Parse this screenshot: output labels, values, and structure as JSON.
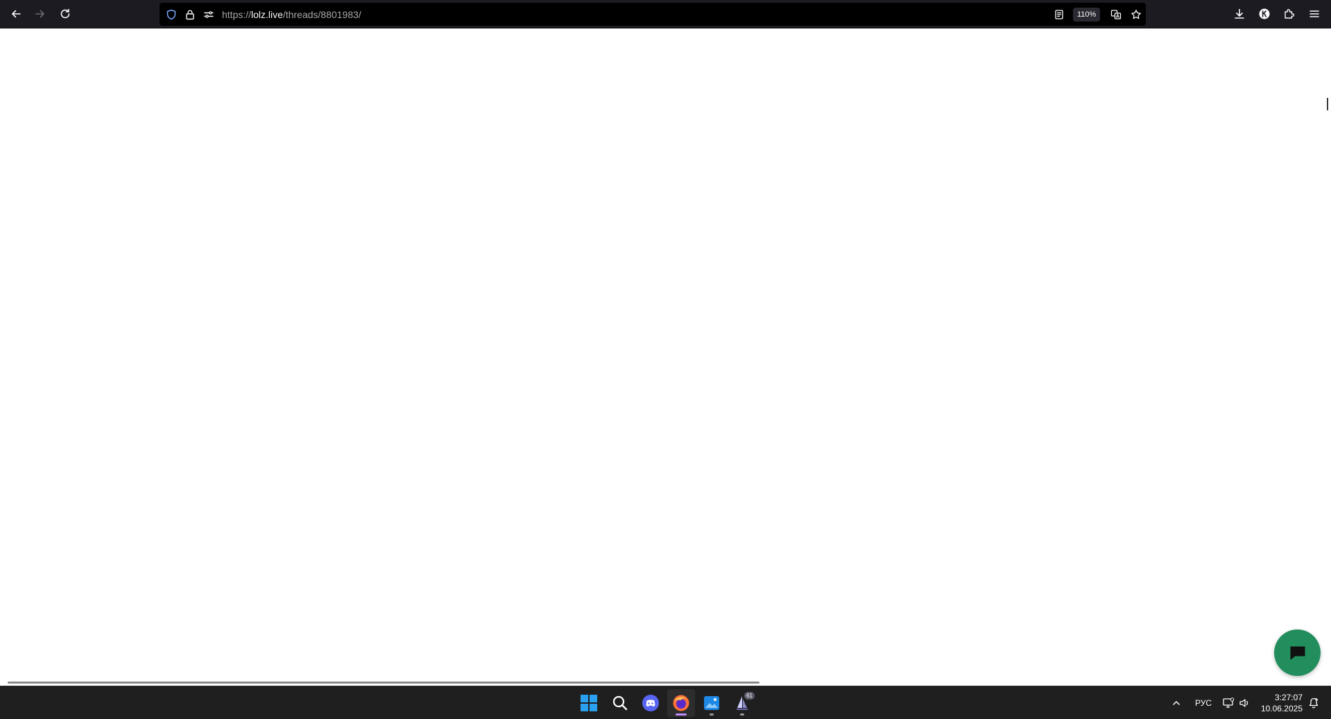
{
  "browser": {
    "url_scheme": "https://",
    "url_host": "lolz.live",
    "url_path": "/threads/8801983/",
    "zoom_level": "110%"
  },
  "icons": {
    "back": "arrow-left-icon",
    "forward": "arrow-right-icon",
    "reload": "reload-icon",
    "tracking_protection": "shield-icon",
    "connection": "lock-icon",
    "permissions": "permissions-icon",
    "reader": "reader-view-icon",
    "translate": "translate-icon",
    "bookmark": "star-icon",
    "downloads": "download-icon",
    "account": "account-icon",
    "extensions": "puzzle-icon",
    "menu": "hamburger-menu-icon",
    "chat": "chat-bubble-icon"
  },
  "taskbar": {
    "apps": [
      "windows-start",
      "search",
      "discord",
      "firefox",
      "photos",
      "app-61"
    ],
    "app_badge": "61",
    "language": "РУС",
    "time": "3:27:07",
    "date": "10.06.2025"
  },
  "colors": {
    "toolbar_bg": "#1c1b22",
    "urlbar_bg": "#000000",
    "chat_button": "#228e5d",
    "taskbar_bg": "#1f1f1f",
    "active_indicator": "#c08cff"
  }
}
